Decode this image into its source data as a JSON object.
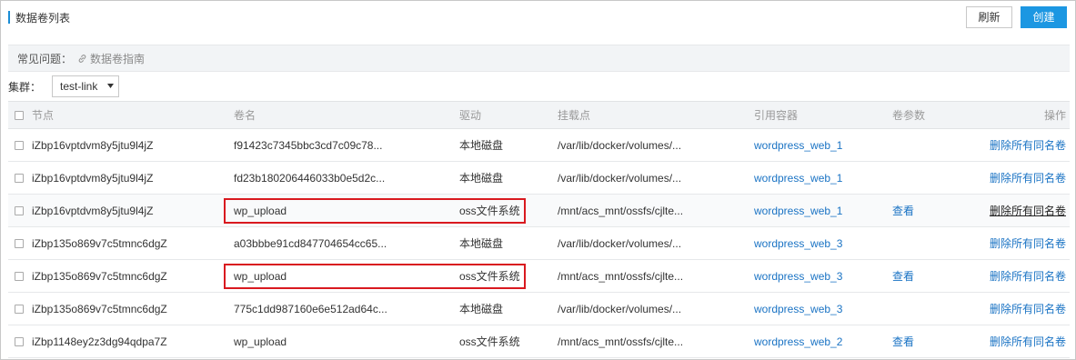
{
  "header": {
    "title": "数据卷列表",
    "refresh_label": "刷新",
    "create_label": "创建"
  },
  "faq": {
    "label": "常见问题：",
    "guide_link": "数据卷指南"
  },
  "cluster": {
    "label": "集群：",
    "selected": "test-link"
  },
  "colors": {
    "accent": "#1c97e2",
    "link": "#1a73c4",
    "highlight": "#d9191f"
  },
  "table": {
    "columns": [
      "节点",
      "卷名",
      "驱动",
      "挂载点",
      "引用容器",
      "卷参数",
      "操作"
    ],
    "rows": [
      {
        "node": "iZbp16vptdvm8y5jtu9l4jZ",
        "volume": "f91423c7345bbc3cd7c09c78...",
        "driver": "本地磁盘",
        "mount": "/var/lib/docker/volumes/...",
        "container": "wordpress_web_1",
        "param": "",
        "action": "删除所有同名卷"
      },
      {
        "node": "iZbp16vptdvm8y5jtu9l4jZ",
        "volume": "fd23b180206446033b0e5d2c...",
        "driver": "本地磁盘",
        "mount": "/var/lib/docker/volumes/...",
        "container": "wordpress_web_1",
        "param": "",
        "action": "删除所有同名卷"
      },
      {
        "node": "iZbp16vptdvm8y5jtu9l4jZ",
        "volume": "wp_upload",
        "driver": "oss文件系统",
        "mount": "/mnt/acs_mnt/ossfs/cjlte...",
        "container": "wordpress_web_1",
        "param": "查看",
        "action": "删除所有同名卷"
      },
      {
        "node": "iZbp135o869v7c5tmnc6dgZ",
        "volume": "a03bbbe91cd847704654cc65...",
        "driver": "本地磁盘",
        "mount": "/var/lib/docker/volumes/...",
        "container": "wordpress_web_3",
        "param": "",
        "action": "删除所有同名卷"
      },
      {
        "node": "iZbp135o869v7c5tmnc6dgZ",
        "volume": "wp_upload",
        "driver": "oss文件系统",
        "mount": "/mnt/acs_mnt/ossfs/cjlte...",
        "container": "wordpress_web_3",
        "param": "查看",
        "action": "删除所有同名卷"
      },
      {
        "node": "iZbp135o869v7c5tmnc6dgZ",
        "volume": "775c1dd987160e6e512ad64c...",
        "driver": "本地磁盘",
        "mount": "/var/lib/docker/volumes/...",
        "container": "wordpress_web_3",
        "param": "",
        "action": "删除所有同名卷"
      },
      {
        "node": "iZbp1148ey2z3dg94qdpa7Z",
        "volume": "wp_upload",
        "driver": "oss文件系统",
        "mount": "/mnt/acs_mnt/ossfs/cjlte...",
        "container": "wordpress_web_2",
        "param": "查看",
        "action": "删除所有同名卷"
      }
    ]
  }
}
